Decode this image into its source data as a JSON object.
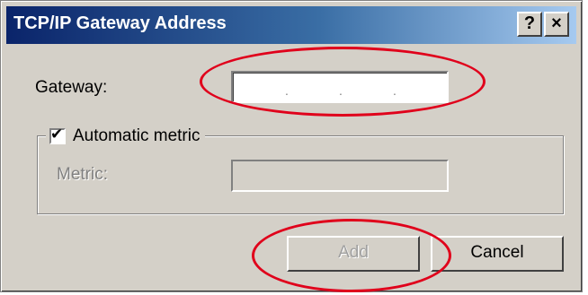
{
  "window": {
    "title": "TCP/IP Gateway Address",
    "help_label": "?",
    "close_label": "×"
  },
  "gateway": {
    "label": "Gateway:",
    "value": ".    .    ."
  },
  "automatic_metric": {
    "label": "Automatic metric",
    "checked": true,
    "check_glyph": "✔"
  },
  "metric": {
    "label": "Metric:",
    "value": ""
  },
  "buttons": {
    "add": "Add",
    "cancel": "Cancel"
  },
  "annotation": {
    "ellipse_color": "#e0001b"
  }
}
